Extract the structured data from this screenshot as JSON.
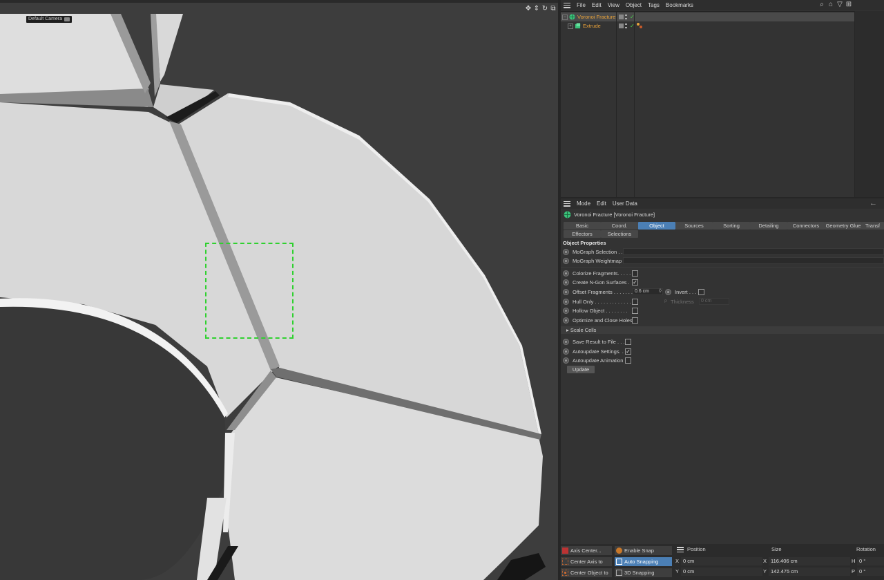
{
  "viewport": {
    "camera_label": "Default Camera"
  },
  "object_manager": {
    "menu": [
      "File",
      "Edit",
      "View",
      "Object",
      "Tags",
      "Bookmarks"
    ],
    "objects": [
      {
        "name": "Voronoi Fracture",
        "selected": true
      },
      {
        "name": "Extrude",
        "selected": false
      }
    ]
  },
  "attribute_manager": {
    "menu": [
      "Mode",
      "Edit",
      "User Data"
    ],
    "object_title": "Voronoi Fracture [Voronoi Fracture]",
    "tabs_row1": [
      "Basic",
      "Coord.",
      "Object",
      "Sources",
      "Sorting",
      "Detailing",
      "Connectors",
      "Geometry Glue",
      "Transf"
    ],
    "tabs_row2": [
      "Effectors",
      "Selections"
    ],
    "active_tab": "Object",
    "section_title": "Object Properties",
    "props": {
      "mograph_selection": "MoGraph Selection . .",
      "mograph_weightmap": "MoGraph Weightmap",
      "colorize_fragments": "Colorize Fragments. . . . .",
      "create_ngon": "Create N-Gon Surfaces .",
      "offset_fragments": "Offset Fragments . . . . . . .",
      "offset_value": "0.6 cm",
      "invert": "Invert . . .",
      "hull_only": "Hull Only . . . . . . . . . . . . .",
      "thickness": "Thickness",
      "thickness_value": "0 cm",
      "hollow_object": "Hollow Object . . . . . . . .",
      "optimize_holes": "Optimize and Close Holes",
      "scale_cells": "Scale Cells",
      "save_result": "Save Result to File . . . .",
      "autoupdate_settings": "Autoupdate Settings. .",
      "autoupdate_animation": "Autoupdate Animation",
      "update_button": "Update"
    },
    "checks": {
      "colorize_fragments": false,
      "create_ngon": true,
      "invert": false,
      "hull_only": false,
      "hollow_object": false,
      "optimize_holes": false,
      "save_result": false,
      "autoupdate_settings": true,
      "autoupdate_animation": false
    }
  },
  "bottom": {
    "buttons": {
      "axis_center": "Axis Center...",
      "center_axis": "Center Axis to",
      "center_object": "Center Object to",
      "enable_snap": "Enable Snap",
      "auto_snapping": "Auto Snapping",
      "snapping_3d": "3D Snapping"
    },
    "headers": {
      "position": "Position",
      "size": "Size",
      "rotation": "Rotation"
    },
    "rows": [
      {
        "axis": "X",
        "pos": "0 cm",
        "size_axis": "X",
        "size": "116.406 cm",
        "rot_axis": "H",
        "rot": "0 °"
      },
      {
        "axis": "Y",
        "pos": "0 cm",
        "size_axis": "Y",
        "size": "142.475 cm",
        "rot_axis": "P",
        "rot": "0 °"
      }
    ]
  },
  "colors": {
    "accent": "#4b7fb5",
    "object_name": "#e8a23a",
    "snap_box": "#2fd12f",
    "check": "#4bd14b"
  }
}
